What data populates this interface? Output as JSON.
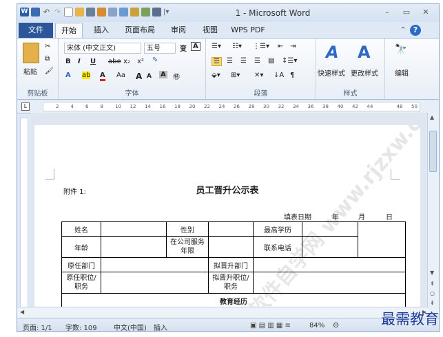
{
  "window": {
    "title": "1 - Microsoft Word",
    "minimize": "–",
    "restore": "▭",
    "close": "✕"
  },
  "quick_access": [
    "W",
    "💾",
    "↶",
    "↷",
    "🗋",
    "📂",
    "🖨"
  ],
  "tabs": [
    "文件",
    "开始",
    "插入",
    "页面布局",
    "审阅",
    "视图",
    "WPS PDF"
  ],
  "help_icons": {
    "collapse": "⌃",
    "help": "?"
  },
  "ribbon": {
    "clipboard": {
      "label": "剪贴板",
      "paste": "粘贴"
    },
    "font": {
      "label": "字体",
      "font_name": "宋体 (中文正文)",
      "font_size": "五号",
      "bold": "B",
      "italic": "I",
      "underline": "U",
      "strike": "abe",
      "sub": "x₂",
      "sup": "x²",
      "grow": "A",
      "shrink": "A",
      "clear": "A",
      "font_color": "A",
      "highlight": "ab",
      "aa": "Aa"
    },
    "paragraph": {
      "label": "段落"
    },
    "styles": {
      "label": "样式",
      "quick": "快速样式",
      "change": "更改样式"
    },
    "editing": {
      "label": "编辑"
    }
  },
  "ruler": {
    "ticks": [
      "2",
      "4",
      "6",
      "8",
      "10",
      "12",
      "14",
      "16",
      "18",
      "20",
      "22",
      "24",
      "26",
      "28",
      "30",
      "32",
      "34",
      "36",
      "38",
      "40",
      "42",
      "44",
      "48",
      "50"
    ]
  },
  "document": {
    "attachment": "附件 1:",
    "heading": "员工晋升公示表",
    "date_row": {
      "label": "填表日期",
      "year": "年",
      "month": "月",
      "day": "日"
    },
    "rows": [
      [
        "姓名",
        "",
        "性别",
        "",
        "最高学历",
        "",
        ""
      ],
      [
        "年龄",
        "",
        "在公司服务年限",
        "",
        "联系电话",
        "",
        ""
      ],
      [
        "原任部门",
        "",
        "",
        "拟晋升部门",
        "",
        "",
        ""
      ],
      [
        "原任职位/职务",
        "",
        "",
        "拟晋升职位/职务",
        "",
        "",
        ""
      ],
      [
        "教育经历"
      ]
    ]
  },
  "status": {
    "page": "页面: 1/1",
    "words": "字数: 109",
    "lang": "中文(中国)",
    "mode": "插入",
    "zoom": "84%"
  },
  "watermark": "软件自学网 www.rjzxw.com",
  "brand": "最需教育"
}
